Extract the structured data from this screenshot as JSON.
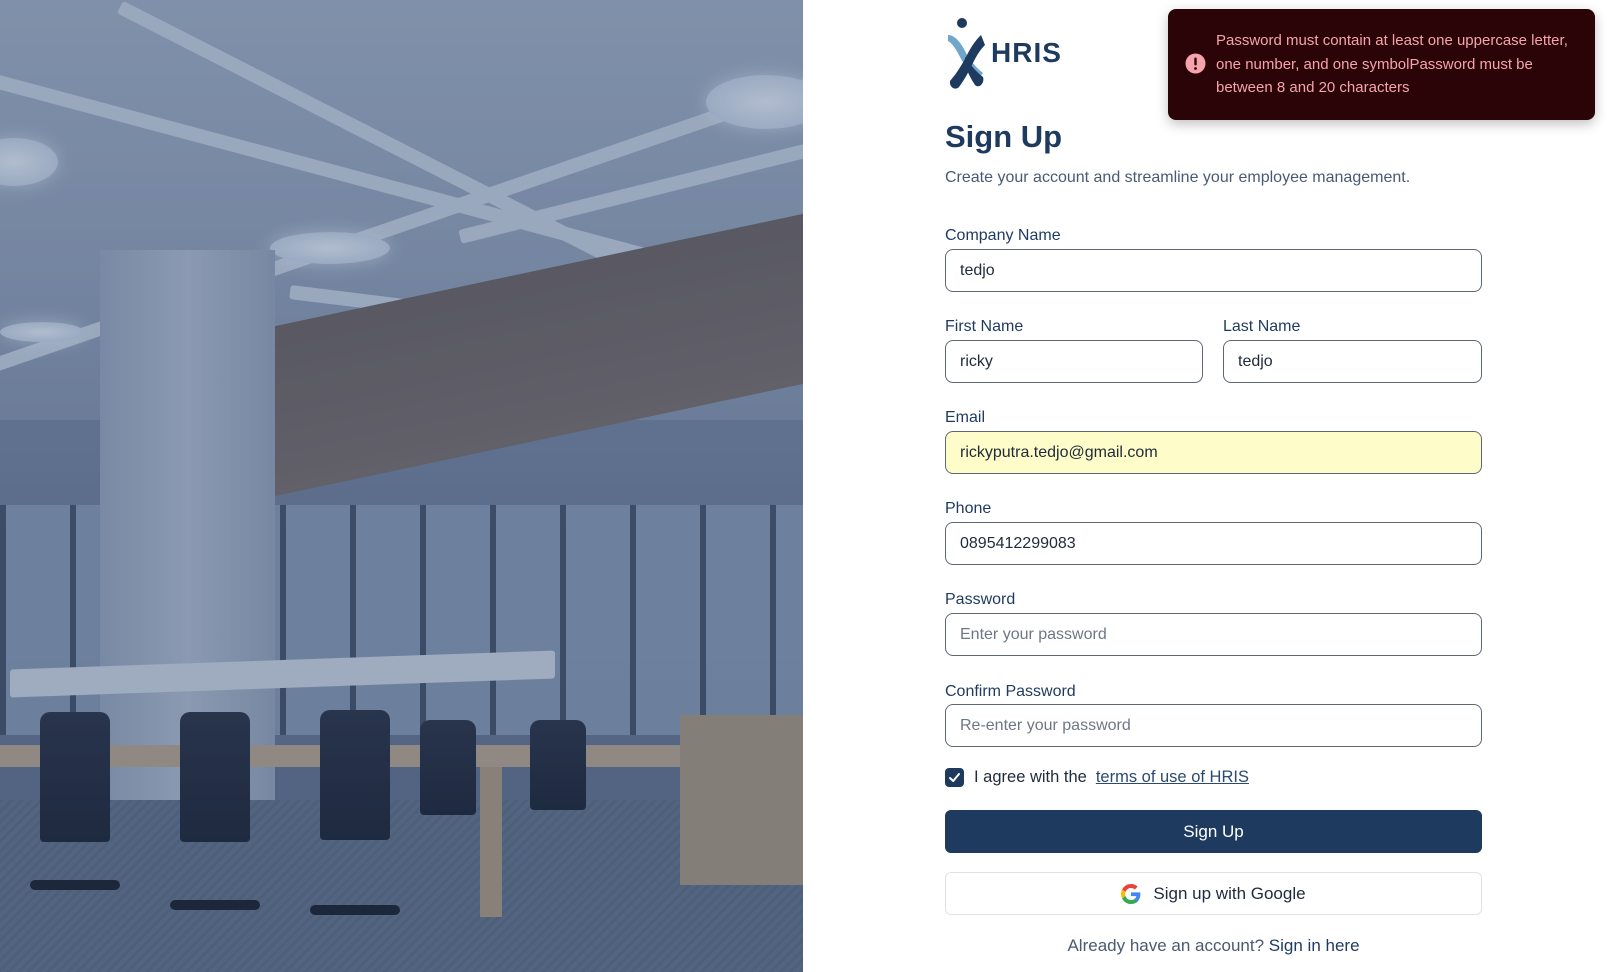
{
  "brand": {
    "logo_text": "HRIS"
  },
  "header": {
    "title": "Sign Up",
    "subtitle": "Create your account and streamline your employee management."
  },
  "form": {
    "company_name": {
      "label": "Company Name",
      "value": "tedjo"
    },
    "first_name": {
      "label": "First Name",
      "value": "ricky"
    },
    "last_name": {
      "label": "Last Name",
      "value": "tedjo"
    },
    "email": {
      "label": "Email",
      "value": "rickyputra.tedjo@gmail.com"
    },
    "phone": {
      "label": "Phone",
      "value": "0895412299083"
    },
    "password": {
      "label": "Password",
      "placeholder": "Enter your password",
      "value": ""
    },
    "confirm_password": {
      "label": "Confirm Password",
      "placeholder": "Re-enter your password",
      "value": ""
    },
    "agree": {
      "checked": true,
      "text": "I agree with the",
      "link_text": "terms of use of HRIS"
    }
  },
  "actions": {
    "signup_label": "Sign Up",
    "google_label": "Sign up with Google",
    "signin_prompt": "Already have an account?",
    "signin_link": "Sign in here"
  },
  "toast": {
    "type": "error",
    "message": "Password must contain at least one uppercase letter, one number, and one symbolPassword must be between 8 and 20 characters",
    "icon": "alert-circle-icon"
  },
  "colors": {
    "primary": "#1e3a5f",
    "toast_bg": "#2a0406",
    "toast_text": "#f7a3ad",
    "autofill_bg": "#fefcc8"
  },
  "icons": [
    "hris-logo-icon",
    "checkmark-icon",
    "google-icon",
    "alert-circle-icon"
  ]
}
